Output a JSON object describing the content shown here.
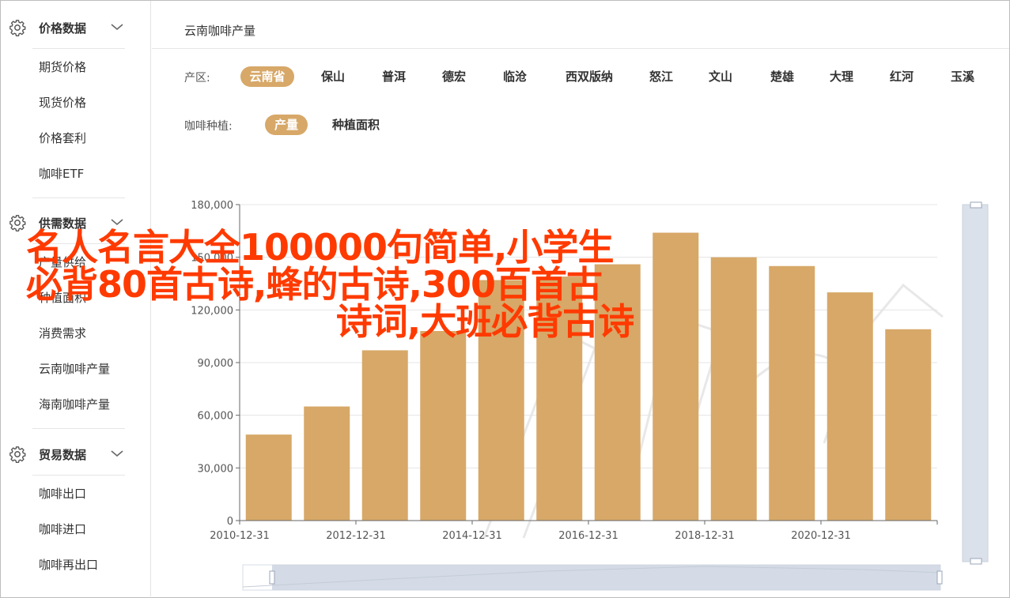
{
  "sidebar": {
    "sections": [
      {
        "title": "价格数据",
        "items": [
          "期货价格",
          "现货价格",
          "价格套利",
          "咖啡ETF"
        ]
      },
      {
        "title": "供需数据",
        "items": [
          "产量供给",
          "种植面积",
          "消费需求",
          "云南咖啡产量",
          "海南咖啡产量"
        ]
      },
      {
        "title": "贸易数据",
        "items": [
          "咖啡出口",
          "咖啡进口",
          "咖啡再出口"
        ]
      }
    ]
  },
  "main": {
    "title": "云南咖啡产量",
    "region_label": "产区:",
    "regions": [
      "云南省",
      "保山",
      "普洱",
      "德宏",
      "临沧",
      "西双版纳",
      "怒江",
      "文山",
      "楚雄",
      "大理",
      "红河",
      "玉溪"
    ],
    "region_selected": "云南省",
    "metric_label": "咖啡种植:",
    "metrics": [
      "产量",
      "种植面积"
    ],
    "metric_selected": "产量"
  },
  "overlay": {
    "line1": "名人名言大全100000句简单,小学生",
    "line2": "必背80首古诗,蜂的古诗,300百首古",
    "line3": "诗词,大班必背古诗"
  },
  "colors": {
    "accent": "#d7a868",
    "bar": "#d7a868",
    "overlay_text": "#ff3a00"
  },
  "chart_data": {
    "type": "bar",
    "x": [
      "2010-12-31",
      "2011-12-31",
      "2012-12-31",
      "2013-12-31",
      "2014-12-31",
      "2015-12-31",
      "2016-12-31",
      "2017-12-31",
      "2018-12-31",
      "2019-12-31",
      "2020-12-31",
      "2021-12-31"
    ],
    "x_tick_labels": [
      "2010-12-31",
      "2012-12-31",
      "2014-12-31",
      "2016-12-31",
      "2018-12-31",
      "2020-12-31"
    ],
    "values": [
      49000,
      65000,
      97000,
      108000,
      137000,
      139000,
      146000,
      164000,
      150000,
      145000,
      130000,
      109000
    ],
    "ylim": [
      0,
      180000
    ],
    "y_ticks": [
      "0",
      "30,000",
      "60,000",
      "90,000",
      "120,000",
      "150,000",
      "180,000"
    ],
    "y_tick_values": [
      0,
      30000,
      60000,
      90000,
      120000,
      150000,
      180000
    ],
    "grid": true,
    "title": "",
    "xlabel": "",
    "ylabel": ""
  }
}
